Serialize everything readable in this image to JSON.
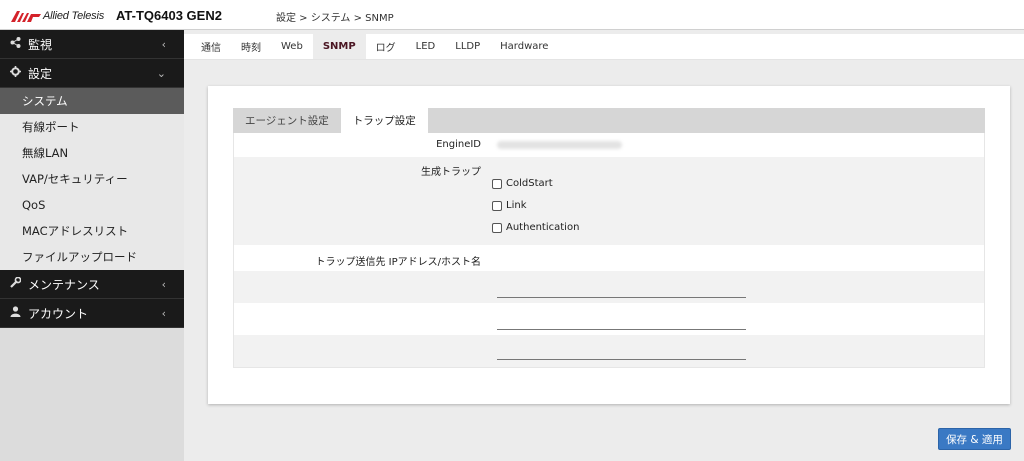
{
  "header": {
    "logo_text": "Allied Telesis",
    "model": "AT-TQ6403 GEN2",
    "breadcrumb": "設定 > システム > SNMP"
  },
  "sidebar": {
    "groups": [
      {
        "label": "監視",
        "icon": "share-icon"
      },
      {
        "label": "設定",
        "icon": "gear-icon"
      }
    ],
    "items": [
      {
        "label": "システム",
        "active": true
      },
      {
        "label": "有線ポート"
      },
      {
        "label": "無線LAN"
      },
      {
        "label": "VAP/セキュリティー"
      },
      {
        "label": "QoS"
      },
      {
        "label": "MACアドレスリスト"
      },
      {
        "label": "ファイルアップロード"
      }
    ],
    "bottom_groups": [
      {
        "label": "メンテナンス",
        "icon": "wrench-icon"
      },
      {
        "label": "アカウント",
        "icon": "user-icon"
      }
    ]
  },
  "tabs": [
    "通信",
    "時刻",
    "Web",
    "SNMP",
    "ログ",
    "LED",
    "LLDP",
    "Hardware"
  ],
  "active_tab": "SNMP",
  "subtabs": [
    "エージェント設定",
    "トラップ設定"
  ],
  "active_subtab": "トラップ設定",
  "form": {
    "engine_id_label": "EngineID",
    "traps_label": "生成トラップ",
    "trap_options": [
      {
        "label": "ColdStart",
        "checked": false
      },
      {
        "label": "Link",
        "checked": false
      },
      {
        "label": "Authentication",
        "checked": false
      }
    ],
    "trap_host_label": "トラップ送信先 IPアドレス/ホスト名",
    "trap_hosts": [
      "",
      "",
      ""
    ]
  },
  "save_button": "保存 & 適用",
  "colors": {
    "accent": "#3a79c4",
    "active_tab": "#4a1522",
    "sidebar_dark": "#1a1a1a"
  }
}
